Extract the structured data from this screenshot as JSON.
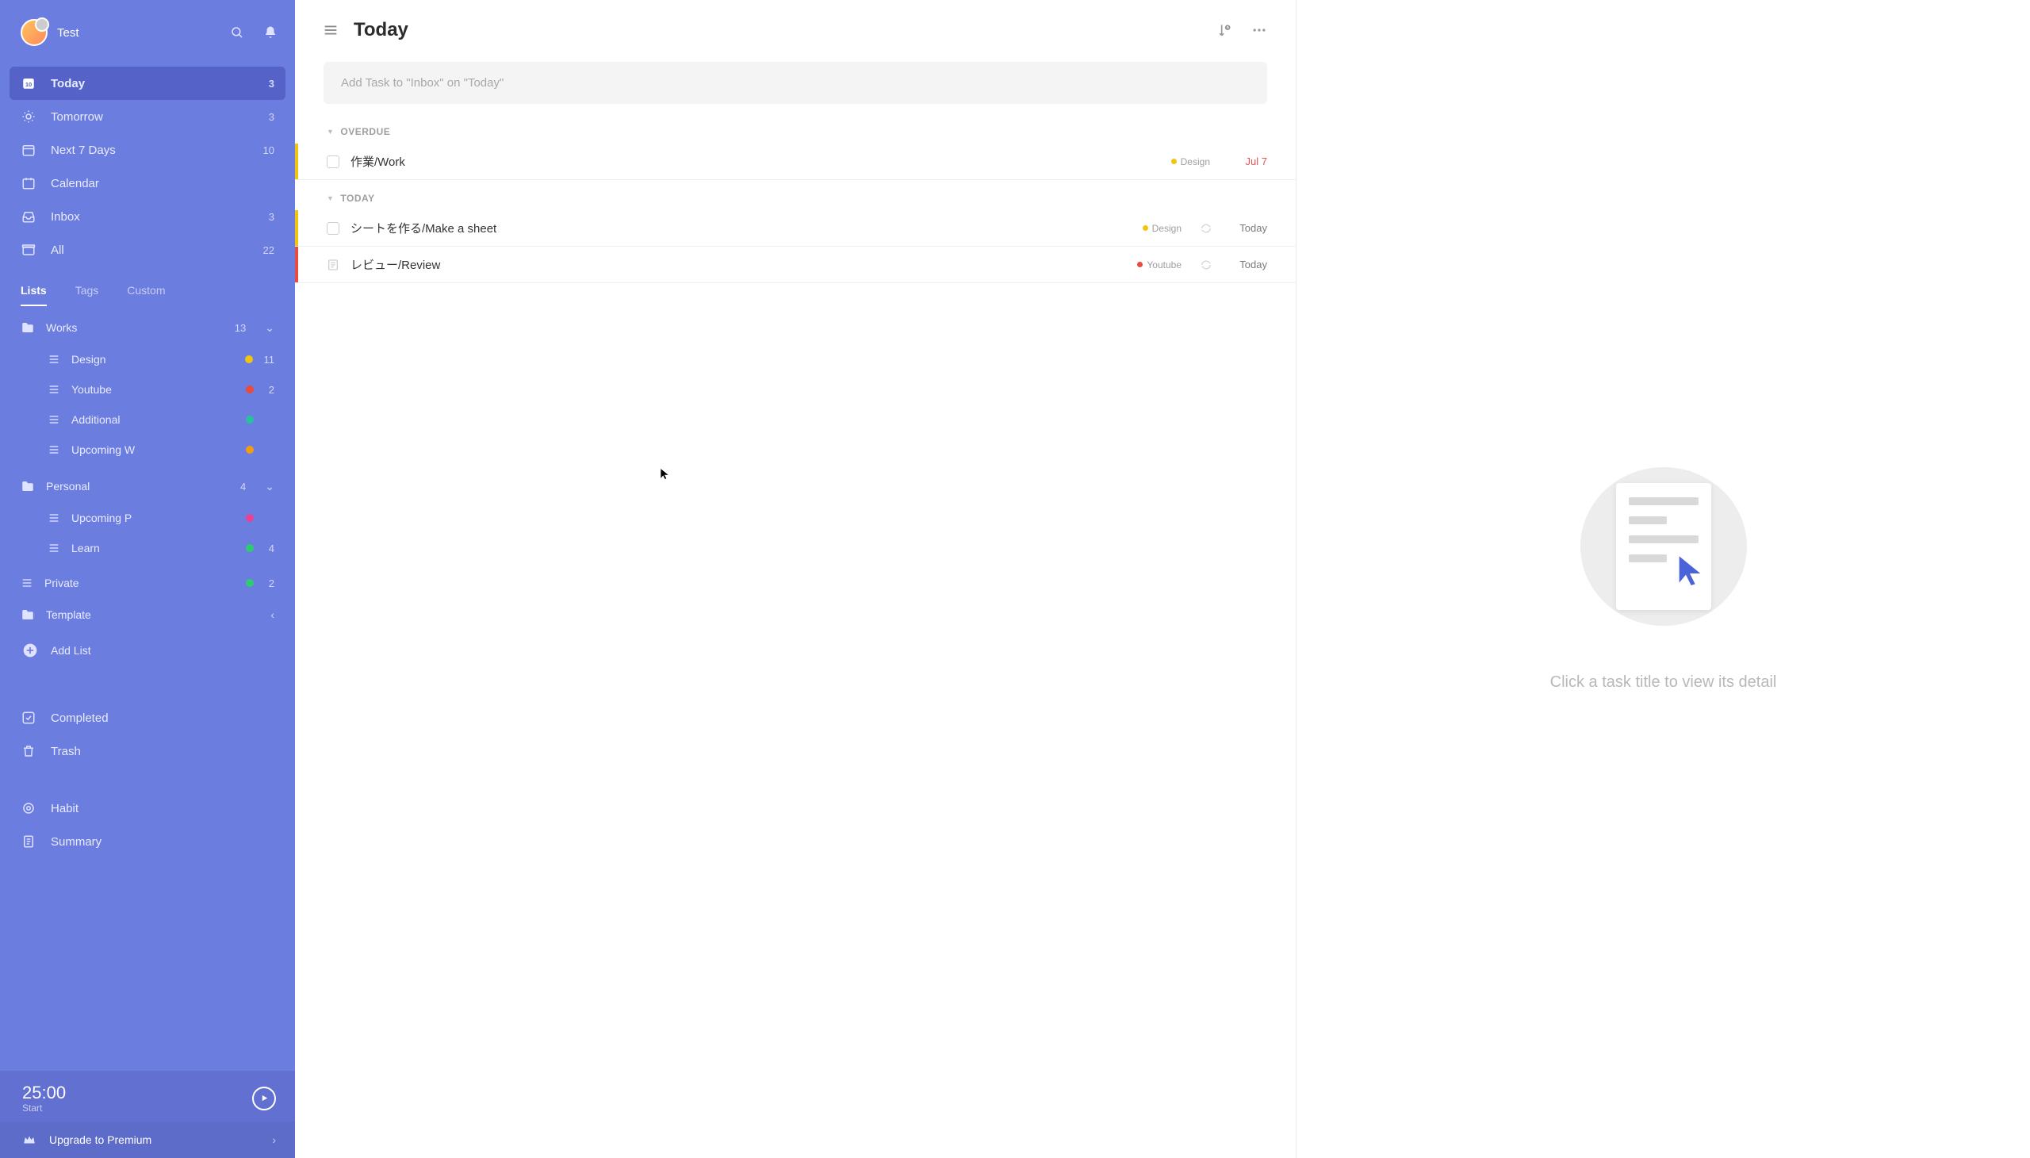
{
  "user": {
    "name": "Test"
  },
  "sidebar": {
    "smart": [
      {
        "name": "today",
        "label": "Today",
        "count": "3",
        "active": true
      },
      {
        "name": "tomorrow",
        "label": "Tomorrow",
        "count": "3",
        "active": false
      },
      {
        "name": "next7",
        "label": "Next 7 Days",
        "count": "10",
        "active": false
      },
      {
        "name": "calendar",
        "label": "Calendar",
        "count": "",
        "active": false
      },
      {
        "name": "inbox",
        "label": "Inbox",
        "count": "3",
        "active": false
      },
      {
        "name": "all",
        "label": "All",
        "count": "22",
        "active": false
      }
    ],
    "tabs": {
      "lists": "Lists",
      "tags": "Tags",
      "custom": "Custom"
    },
    "folders": [
      {
        "name": "works",
        "label": "Works",
        "count": "13",
        "children": [
          {
            "name": "design",
            "label": "Design",
            "color": "#f1c40f",
            "count": "11"
          },
          {
            "name": "youtube",
            "label": "Youtube",
            "color": "#e74c3c",
            "count": "2"
          },
          {
            "name": "additional",
            "label": "Additional",
            "color": "#27c29d",
            "count": ""
          },
          {
            "name": "upcomingw",
            "label": "Upcoming W",
            "color": "#f39c12",
            "count": ""
          }
        ]
      },
      {
        "name": "personal",
        "label": "Personal",
        "count": "4",
        "children": [
          {
            "name": "upcomingp",
            "label": "Upcoming P",
            "color": "#e84393",
            "count": ""
          },
          {
            "name": "learn",
            "label": "Learn",
            "color": "#2ecc71",
            "count": "4"
          }
        ]
      }
    ],
    "flat_lists": [
      {
        "name": "private",
        "label": "Private",
        "color": "#2ecc71",
        "count": "2",
        "chev": ""
      },
      {
        "name": "template",
        "label": "Template",
        "color": "",
        "count": "",
        "chev": "‹"
      }
    ],
    "add_list": "Add List",
    "bottom": [
      {
        "name": "completed",
        "label": "Completed"
      },
      {
        "name": "trash",
        "label": "Trash"
      }
    ],
    "extras": [
      {
        "name": "habit",
        "label": "Habit"
      },
      {
        "name": "summary",
        "label": "Summary"
      }
    ],
    "timer": {
      "time": "25:00",
      "sub": "Start"
    },
    "upgrade": "Upgrade to Premium"
  },
  "main": {
    "title": "Today",
    "add_placeholder": "Add Task to \"Inbox\" on \"Today\"",
    "sections": {
      "overdue": {
        "title": "OVERDUE",
        "tasks": [
          {
            "title": "作業/Work",
            "list": "Design",
            "list_color": "#f1c40f",
            "due": "Jul 7",
            "overdue": true,
            "bar": "#f1c40f",
            "repeat": false
          }
        ]
      },
      "today": {
        "title": "TODAY",
        "tasks": [
          {
            "title": "シートを作る/Make a sheet",
            "list": "Design",
            "list_color": "#f1c40f",
            "due": "Today",
            "overdue": false,
            "bar": "#f1c40f",
            "repeat": true
          },
          {
            "title": "レビュー/Review",
            "list": "Youtube",
            "list_color": "#e74c3c",
            "due": "Today",
            "overdue": false,
            "bar": "#e74c3c",
            "repeat": true,
            "subtask": true
          }
        ]
      }
    }
  },
  "detail": {
    "empty_text": "Click a task title to view its detail"
  }
}
